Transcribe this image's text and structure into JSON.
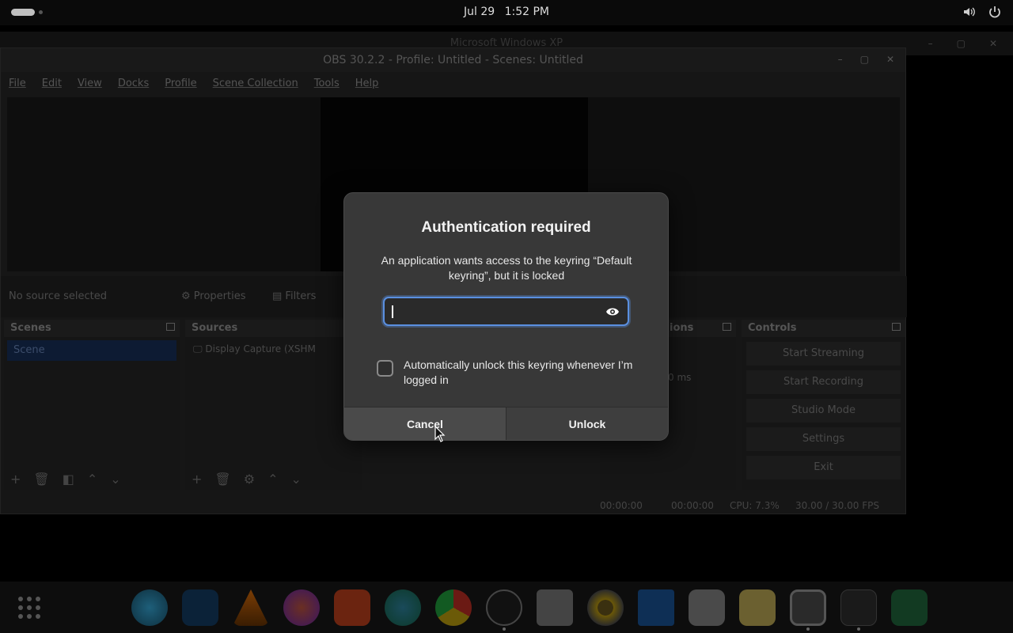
{
  "topbar": {
    "date": "Jul 29",
    "time": "1:52 PM"
  },
  "background_window": {
    "title": "Microsoft Windows XP"
  },
  "obs": {
    "title": "OBS 30.2.2 - Profile: Untitled - Scenes: Untitled",
    "menu": [
      "File",
      "Edit",
      "View",
      "Docks",
      "Profile",
      "Scene Collection",
      "Tools",
      "Help"
    ],
    "source_bar": {
      "no_source": "No source selected",
      "properties": "Properties",
      "filters": "Filters"
    },
    "panels": {
      "scenes_title": "Scenes",
      "scene_item": "Scene",
      "sources_title": "Sources",
      "source_item": "Display Capture (XSHM",
      "transitions_title": "ions",
      "transition_ms": "0 ms",
      "controls_title": "Controls",
      "controls": [
        "Start Streaming",
        "Start Recording",
        "Studio Mode",
        "Settings",
        "Exit"
      ]
    },
    "status": {
      "rec_time": "00:00:00",
      "stream_time": "00:00:00",
      "cpu": "CPU: 7.3%",
      "fps": "30.00 / 30.00 FPS"
    }
  },
  "dialog": {
    "title": "Authentication required",
    "message": "An application wants access to the keyring “Default keyring”, but it is locked",
    "password_value": "",
    "checkbox_label": "Automatically unlock this keyring whenever I’m logged in",
    "cancel_label": "Cancel",
    "unlock_label": "Unlock"
  },
  "dock": {
    "apps": [
      "app-grid-icon",
      "globe-icon",
      "vscode-icon",
      "vlc-icon",
      "firefox-icon",
      "brave-icon",
      "edge-dev-icon",
      "chrome-dev-icon",
      "obs-icon",
      "files-icon",
      "rhythmbox-icon",
      "document-viewer-icon",
      "software-store-icon",
      "text-editor-icon",
      "screenshot-icon",
      "terminal-icon",
      "spreadsheet-icon"
    ]
  },
  "colors": {
    "accent": "#5a8fe0",
    "dialog_bg": "#383838"
  }
}
